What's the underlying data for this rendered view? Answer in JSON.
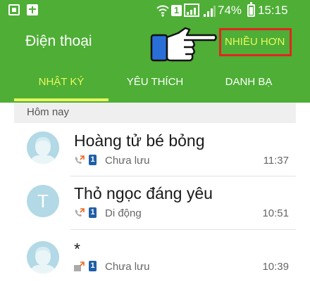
{
  "status_bar": {
    "battery": "74%",
    "time": "15:15",
    "sim_label": "1"
  },
  "header": {
    "title": "Điện thoại",
    "more_label": "NHIỀU HƠN"
  },
  "tabs": [
    {
      "label": "NHẬT KÝ",
      "active": true
    },
    {
      "label": "YÊU THÍCH",
      "active": false
    },
    {
      "label": "DANH BẠ",
      "active": false
    }
  ],
  "section": {
    "label": "Hôm nay"
  },
  "calls": [
    {
      "name": "Hoàng tử bé bỏng",
      "detail": "Chưa lưu",
      "time": "11:37",
      "sim": "1",
      "avatar": "person-icon",
      "call_type": "outgoing"
    },
    {
      "name": "Thỏ ngọc đáng yêu",
      "detail": "Di động",
      "time": "10:51",
      "sim": "1",
      "avatar_letter": "T",
      "call_type": "outgoing"
    },
    {
      "name": "*",
      "detail": "Chưa lưu",
      "time": "10:39",
      "sim": "1",
      "avatar": "person-icon",
      "call_type": "outgoing-cancelled"
    }
  ],
  "colors": {
    "header_green": "#4eae35",
    "accent_yellow": "#e8f95e",
    "highlight_red": "#e0261f",
    "avatar_blue": "#b2d9e5",
    "sim_blue": "#1f5ea8"
  }
}
